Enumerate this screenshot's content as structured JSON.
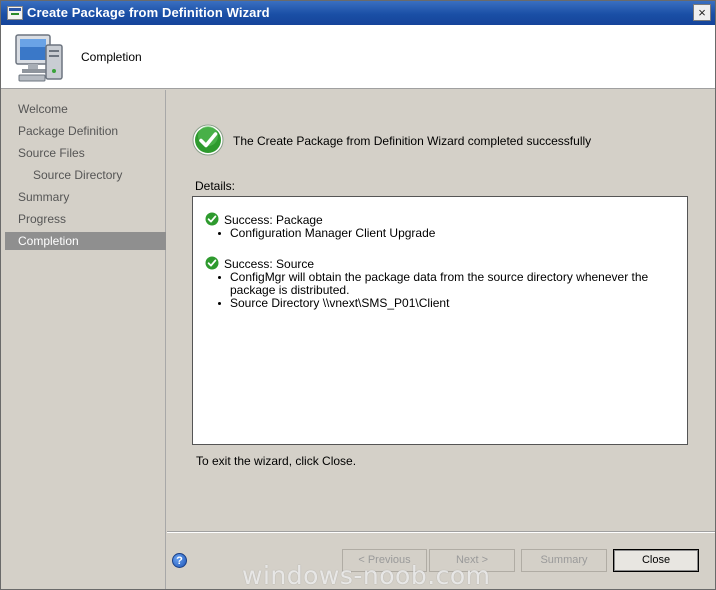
{
  "window": {
    "title": "Create Package from Definition Wizard",
    "close_glyph": "×"
  },
  "header": {
    "title": "Completion",
    "icon": "computer-icon"
  },
  "sidebar": {
    "items": [
      {
        "label": "Welcome",
        "active": false,
        "sub": false
      },
      {
        "label": "Package Definition",
        "active": false,
        "sub": false
      },
      {
        "label": "Source Files",
        "active": false,
        "sub": false
      },
      {
        "label": "Source Directory",
        "active": false,
        "sub": true
      },
      {
        "label": "Summary",
        "active": false,
        "sub": false
      },
      {
        "label": "Progress",
        "active": false,
        "sub": false
      },
      {
        "label": "Completion",
        "active": true,
        "sub": false
      }
    ]
  },
  "main": {
    "status_message": "The Create Package from Definition Wizard completed successfully",
    "details_label": "Details:",
    "details": [
      {
        "heading": "Success: Package",
        "bullets": [
          "Configuration Manager Client Upgrade"
        ]
      },
      {
        "heading": "Success: Source",
        "bullets": [
          "ConfigMgr will obtain the package data from the source directory whenever the package is distributed.",
          "Source Directory \\\\vnext\\SMS_P01\\Client"
        ]
      }
    ],
    "exit_text": "To exit the wizard, click Close."
  },
  "footer": {
    "help_glyph": "?",
    "previous_label": "< Previous",
    "next_label": "Next >",
    "summary_label": "Summary",
    "close_label": "Close"
  },
  "watermark": "windows-noob.com",
  "colors": {
    "titlebar": "#1a4fa6",
    "active_nav": "#8f8f8f",
    "success_green": "#2e9a2e",
    "panel": "#d4d0c8"
  }
}
